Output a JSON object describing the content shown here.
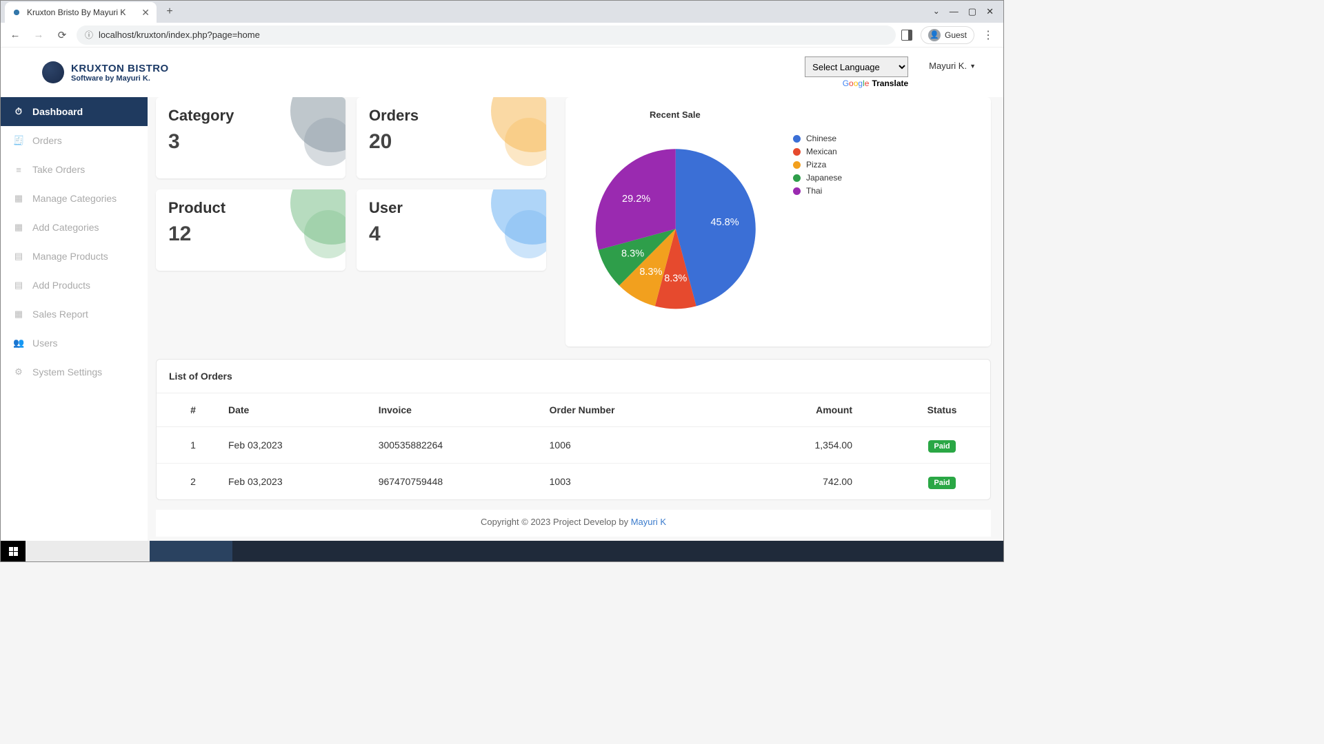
{
  "browser": {
    "tab_title": "Kruxton Bristo By Mayuri K",
    "url": "localhost/kruxton/index.php?page=home",
    "guest_label": "Guest"
  },
  "brand": {
    "name": "KRUXTON BISTRO",
    "subtitle": "Software by Mayuri K."
  },
  "header": {
    "language_placeholder": "Select Language",
    "translate_label": "Translate",
    "user_name": "Mayuri K."
  },
  "sidebar": {
    "items": [
      {
        "label": "Dashboard",
        "icon": "⏱",
        "active": true
      },
      {
        "label": "Orders",
        "icon": "🧾"
      },
      {
        "label": "Take Orders",
        "icon": "≡"
      },
      {
        "label": "Manage Categories",
        "icon": "▦"
      },
      {
        "label": "Add Categories",
        "icon": "▦"
      },
      {
        "label": "Manage Products",
        "icon": "▤"
      },
      {
        "label": "Add Products",
        "icon": "▤"
      },
      {
        "label": "Sales Report",
        "icon": "▦"
      },
      {
        "label": "Users",
        "icon": "👥"
      },
      {
        "label": "System Settings",
        "icon": "⚙"
      }
    ]
  },
  "stats": [
    {
      "label": "Category",
      "value": "3",
      "tone": "gray"
    },
    {
      "label": "Orders",
      "value": "20",
      "tone": "orange"
    },
    {
      "label": "Product",
      "value": "12",
      "tone": "green"
    },
    {
      "label": "User",
      "value": "4",
      "tone": "blue"
    }
  ],
  "chart_data": {
    "type": "pie",
    "title": "Recent Sale",
    "series": [
      {
        "name": "Chinese",
        "value": 45.8,
        "color": "#3b6fd6",
        "label": "45.8%"
      },
      {
        "name": "Mexican",
        "value": 8.3,
        "color": "#e64a2e",
        "label": "8.3%"
      },
      {
        "name": "Pizza",
        "value": 8.3,
        "color": "#f2a01e",
        "label": "8.3%"
      },
      {
        "name": "Japanese",
        "value": 8.3,
        "color": "#2e9e4a",
        "label": "8.3%"
      },
      {
        "name": "Thai",
        "value": 29.2,
        "color": "#9a2ab0",
        "label": "29.2%"
      }
    ]
  },
  "orders_table": {
    "title": "List of Orders",
    "columns": [
      "#",
      "Date",
      "Invoice",
      "Order Number",
      "Amount",
      "Status"
    ],
    "rows": [
      {
        "n": "1",
        "date": "Feb 03,2023",
        "invoice": "300535882264",
        "order": "1006",
        "amount": "1,354.00",
        "status": "Paid"
      },
      {
        "n": "2",
        "date": "Feb 03,2023",
        "invoice": "967470759448",
        "order": "1003",
        "amount": "742.00",
        "status": "Paid"
      }
    ]
  },
  "footer": {
    "text": "Copyright © 2023 Project Develop by ",
    "link_text": "Mayuri K"
  }
}
